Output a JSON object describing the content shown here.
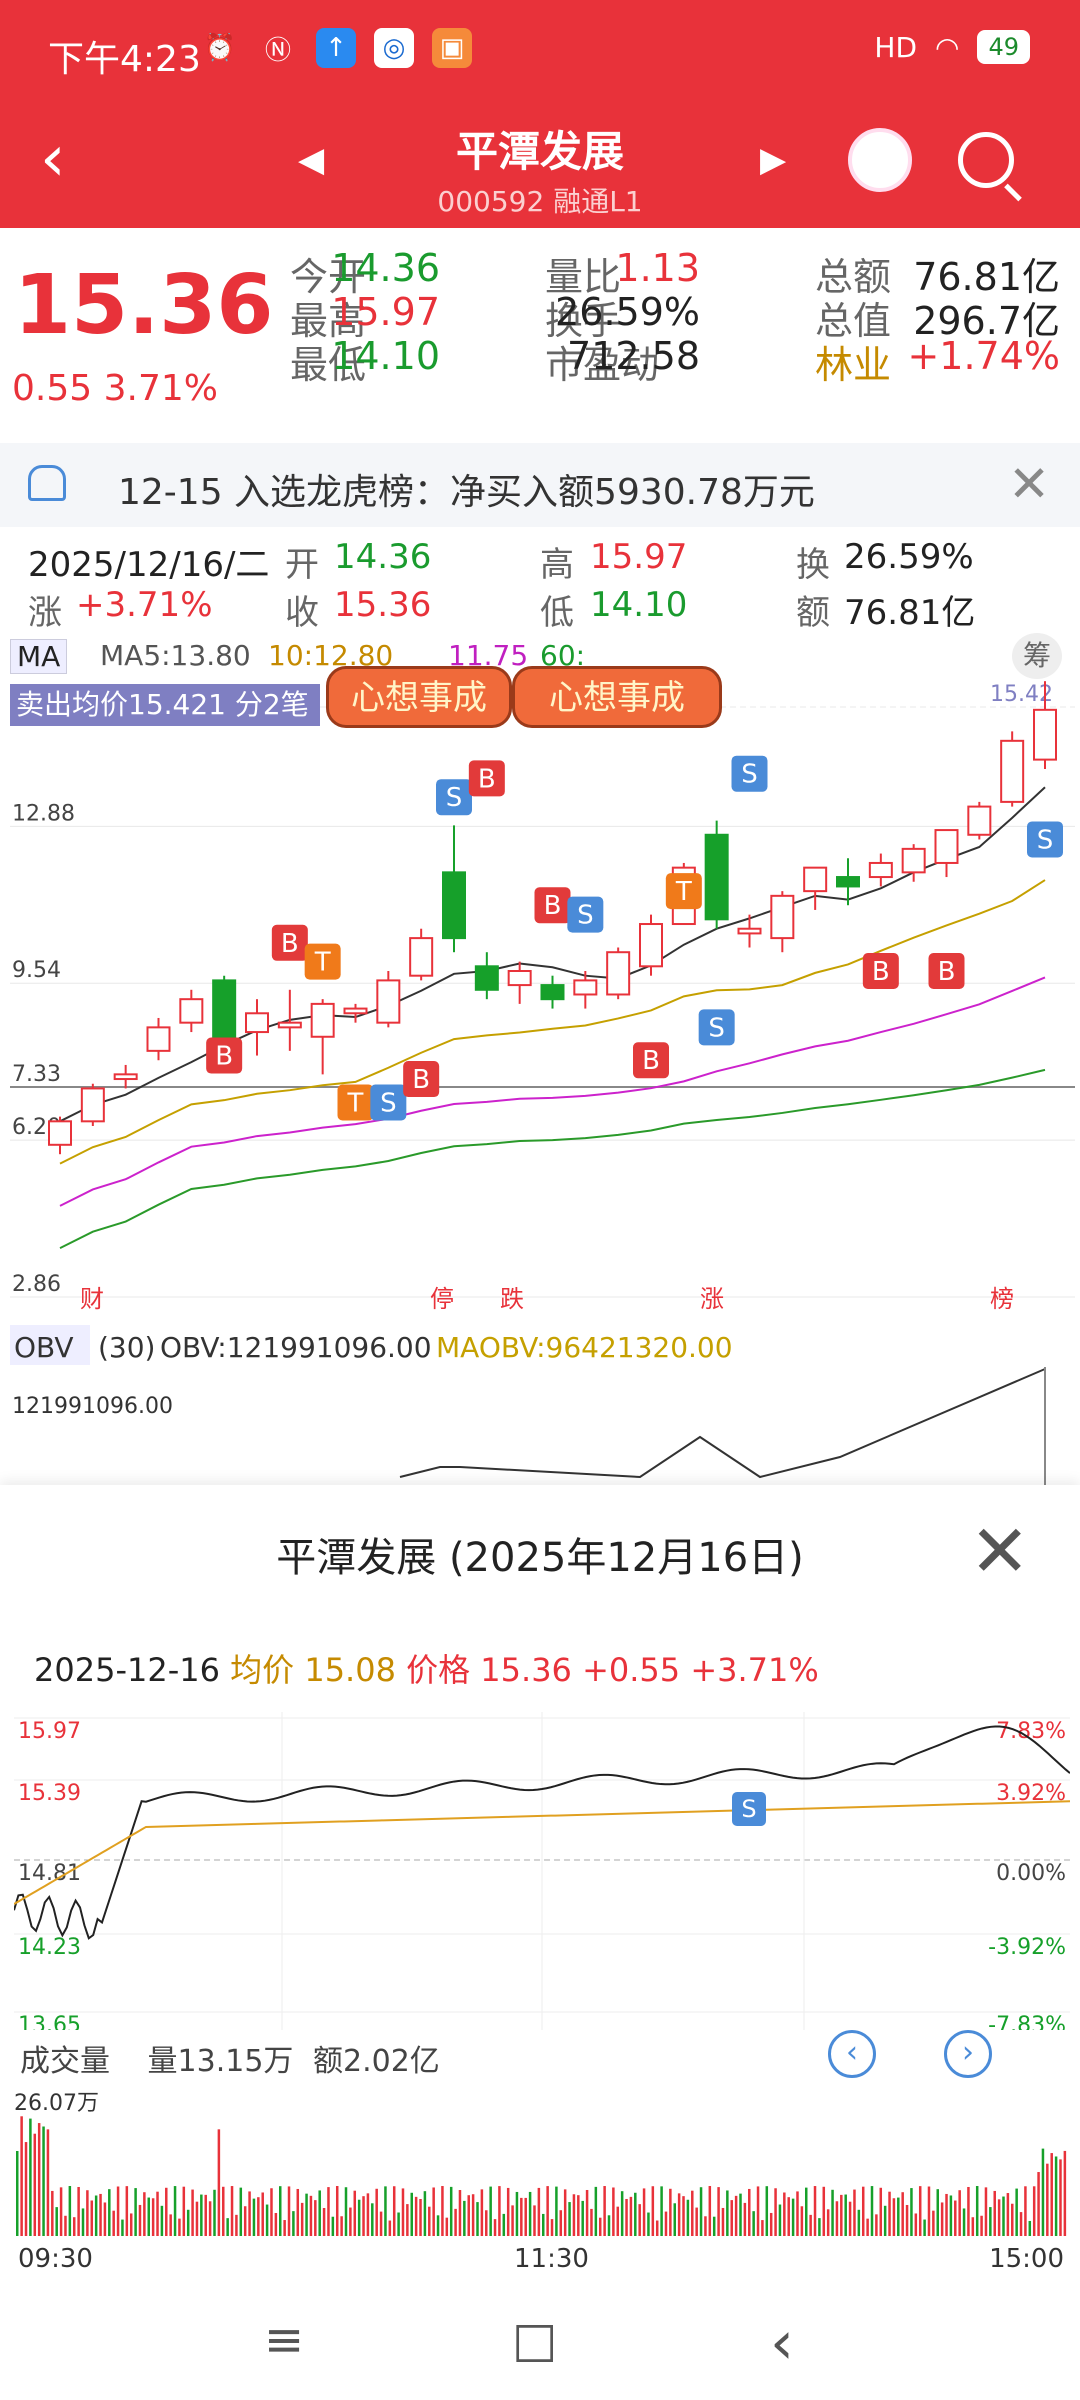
{
  "status_bar": {
    "time": "下午4:23",
    "signal": "HD",
    "battery": "49"
  },
  "nav": {
    "stock_name": "平潭发展",
    "stock_code": "000592",
    "tags": "融通L1"
  },
  "quote": {
    "price": "15.36",
    "change": "0.55",
    "change_pct": "3.71%",
    "fields": [
      {
        "label": "今开",
        "value": "14.36",
        "vclass": "green"
      },
      {
        "label": "量比",
        "value": "1.13",
        "vclass": "red"
      },
      {
        "label": "总额",
        "value": "76.81亿",
        "vclass": ""
      },
      {
        "label": "最高",
        "value": "15.97",
        "vclass": "red"
      },
      {
        "label": "换手",
        "value": "26.59%",
        "vclass": ""
      },
      {
        "label": "总值",
        "value": "296.7亿",
        "vclass": ""
      },
      {
        "label": "最低",
        "value": "14.10",
        "vclass": "green"
      },
      {
        "label": "市盈动",
        "value": "712.58",
        "vclass": ""
      },
      {
        "label": "林业",
        "value": "+1.74%",
        "vclass": "red"
      }
    ]
  },
  "notice": {
    "text": "12-15 入选龙虎榜：净买入额5930.78万元"
  },
  "day_info": {
    "date": "2025/12/16/二",
    "open_label": "开",
    "open": "14.36",
    "high_label": "高",
    "high": "15.97",
    "turnover_label": "换",
    "turnover": "26.59%",
    "chg_label": "涨",
    "chg": "+3.71%",
    "close_label": "收",
    "close": "15.36",
    "low_label": "低",
    "low": "14.10",
    "amount_label": "额",
    "amount": "76.81亿"
  },
  "ma_bar": {
    "dropdown": "MA",
    "ma5": "MA5:13.80",
    "ma10": "10:12.80",
    "ma20": "11.75",
    "ma60": "60:",
    "chip_button": "筹",
    "sell_avg": "卖出均价15.421 分2笔",
    "tiger_text": "心想事成"
  },
  "chart_data": [
    {
      "type": "candlestick",
      "title": "",
      "y_ticks": [
        "15.42",
        "12.88",
        "9.54",
        "7.33",
        "6.20",
        "2.86"
      ],
      "markers": [
        "B",
        "T",
        "S"
      ],
      "event_labels": [
        "财",
        "停",
        "跌",
        "涨",
        "榜"
      ],
      "candles": [
        {
          "o": 6.1,
          "h": 6.7,
          "l": 5.9,
          "c": 6.6
        },
        {
          "o": 6.6,
          "h": 7.4,
          "l": 6.5,
          "c": 7.3
        },
        {
          "o": 7.5,
          "h": 7.8,
          "l": 7.3,
          "c": 7.6
        },
        {
          "o": 8.1,
          "h": 8.8,
          "l": 7.9,
          "c": 8.6
        },
        {
          "o": 8.7,
          "h": 9.4,
          "l": 8.5,
          "c": 9.2
        },
        {
          "o": 9.6,
          "h": 9.7,
          "l": 8.3,
          "c": 8.4
        },
        {
          "o": 8.5,
          "h": 9.2,
          "l": 8.0,
          "c": 8.9
        },
        {
          "o": 8.6,
          "h": 9.4,
          "l": 8.1,
          "c": 8.7
        },
        {
          "o": 8.4,
          "h": 9.2,
          "l": 7.6,
          "c": 9.1
        },
        {
          "o": 8.9,
          "h": 9.1,
          "l": 8.7,
          "c": 9.0
        },
        {
          "o": 8.7,
          "h": 9.8,
          "l": 8.6,
          "c": 9.6
        },
        {
          "o": 9.7,
          "h": 10.7,
          "l": 9.6,
          "c": 10.5
        },
        {
          "o": 11.9,
          "h": 12.9,
          "l": 10.2,
          "c": 10.5
        },
        {
          "o": 9.9,
          "h": 10.2,
          "l": 9.2,
          "c": 9.4
        },
        {
          "o": 9.5,
          "h": 10.0,
          "l": 9.1,
          "c": 9.8
        },
        {
          "o": 9.5,
          "h": 9.7,
          "l": 9.0,
          "c": 9.2
        },
        {
          "o": 9.3,
          "h": 9.8,
          "l": 9.0,
          "c": 9.6
        },
        {
          "o": 9.3,
          "h": 10.3,
          "l": 9.2,
          "c": 10.2
        },
        {
          "o": 9.9,
          "h": 11.0,
          "l": 9.7,
          "c": 10.8
        },
        {
          "o": 10.8,
          "h": 12.1,
          "l": 10.8,
          "c": 12.0
        },
        {
          "o": 12.7,
          "h": 13.0,
          "l": 10.7,
          "c": 10.9
        },
        {
          "o": 10.6,
          "h": 11.0,
          "l": 10.3,
          "c": 10.7
        },
        {
          "o": 10.5,
          "h": 11.5,
          "l": 10.2,
          "c": 11.4
        },
        {
          "o": 11.5,
          "h": 12.0,
          "l": 11.1,
          "c": 12.0
        },
        {
          "o": 11.8,
          "h": 12.2,
          "l": 11.2,
          "c": 11.6
        },
        {
          "o": 11.8,
          "h": 12.3,
          "l": 11.6,
          "c": 12.1
        },
        {
          "o": 11.9,
          "h": 12.5,
          "l": 11.7,
          "c": 12.4
        },
        {
          "o": 12.1,
          "h": 12.8,
          "l": 11.8,
          "c": 12.8
        },
        {
          "o": 12.7,
          "h": 13.4,
          "l": 12.6,
          "c": 13.3
        },
        {
          "o": 13.4,
          "h": 14.9,
          "l": 13.3,
          "c": 14.7
        },
        {
          "o": 14.3,
          "h": 15.97,
          "l": 14.1,
          "c": 15.36
        }
      ]
    },
    {
      "type": "line",
      "title": "OBV",
      "indicator_label": "(30)",
      "obv": "OBV:121991096.00",
      "maobv": "MAOBV:96421320.00",
      "y_top": "121991096.00"
    },
    {
      "type": "line",
      "title": "平潭发展 (2025年12月16日)",
      "date": "2025-12-16",
      "avg_label": "均价",
      "avg": "15.08",
      "price_label": "价格",
      "price": "15.36",
      "change": "+0.55",
      "change_pct": "+3.71%",
      "y_left": [
        "15.97",
        "15.39",
        "14.81",
        "14.23",
        "13.65"
      ],
      "y_right": [
        "7.83%",
        "3.92%",
        "0.00%",
        "-3.92%",
        "-7.83%"
      ],
      "x_labels": [
        "09:30",
        "11:30",
        "15:00"
      ],
      "volume_label": "成交量",
      "volume": "量13.15万",
      "amount": "额2.02亿",
      "vol_max": "26.07万"
    }
  ],
  "bottom_nav": {
    "menu": "≡",
    "home": "□",
    "back": "‹"
  }
}
